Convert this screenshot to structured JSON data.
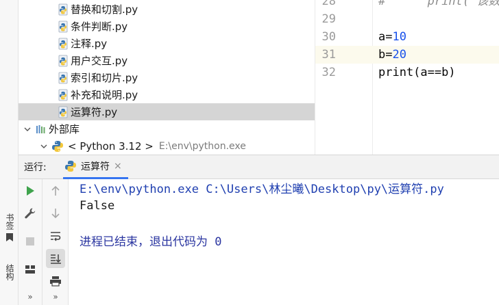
{
  "tool_strip": {
    "bookmarks_label": "书签",
    "structure_label": "结构"
  },
  "project_tree": {
    "files": [
      {
        "label": "替换和切割.py",
        "selected": false
      },
      {
        "label": "条件判断.py",
        "selected": false
      },
      {
        "label": "注释.py",
        "selected": false
      },
      {
        "label": "用户交互.py",
        "selected": false
      },
      {
        "label": "索引和切片.py",
        "selected": false
      },
      {
        "label": "补充和说明.py",
        "selected": false
      },
      {
        "label": "运算符.py",
        "selected": true
      }
    ],
    "external_libs_label": "外部库",
    "sdk_label": "< Python 3.12 >",
    "sdk_path": "E:\\env\\python.exe"
  },
  "editor": {
    "lines": [
      {
        "number": "28",
        "code": "#      print( 该数"
      },
      {
        "number": "29",
        "code": ""
      },
      {
        "number": "30",
        "code": "a=10"
      },
      {
        "number": "31",
        "code": "b=20"
      },
      {
        "number": "32",
        "code": "print(a==b)"
      }
    ],
    "current_line": "31"
  },
  "run_panel": {
    "title": "运行:",
    "tab_label": "运算符",
    "tab_close": "×",
    "toolbar_more": "»",
    "console": {
      "command_line": "E:\\env\\python.exe C:\\Users\\林尘曦\\Desktop\\py\\运算符.py",
      "output": "False",
      "exit_message": "进程已结束，退出代码为 0"
    }
  },
  "colors": {
    "selection": "#d5d5d5",
    "current_line": "#fcfaed",
    "number_literal": "#1750eb",
    "console_command": "#1f3fb0",
    "tab_underline": "#3574f0",
    "run_green": "#3fa34d"
  }
}
